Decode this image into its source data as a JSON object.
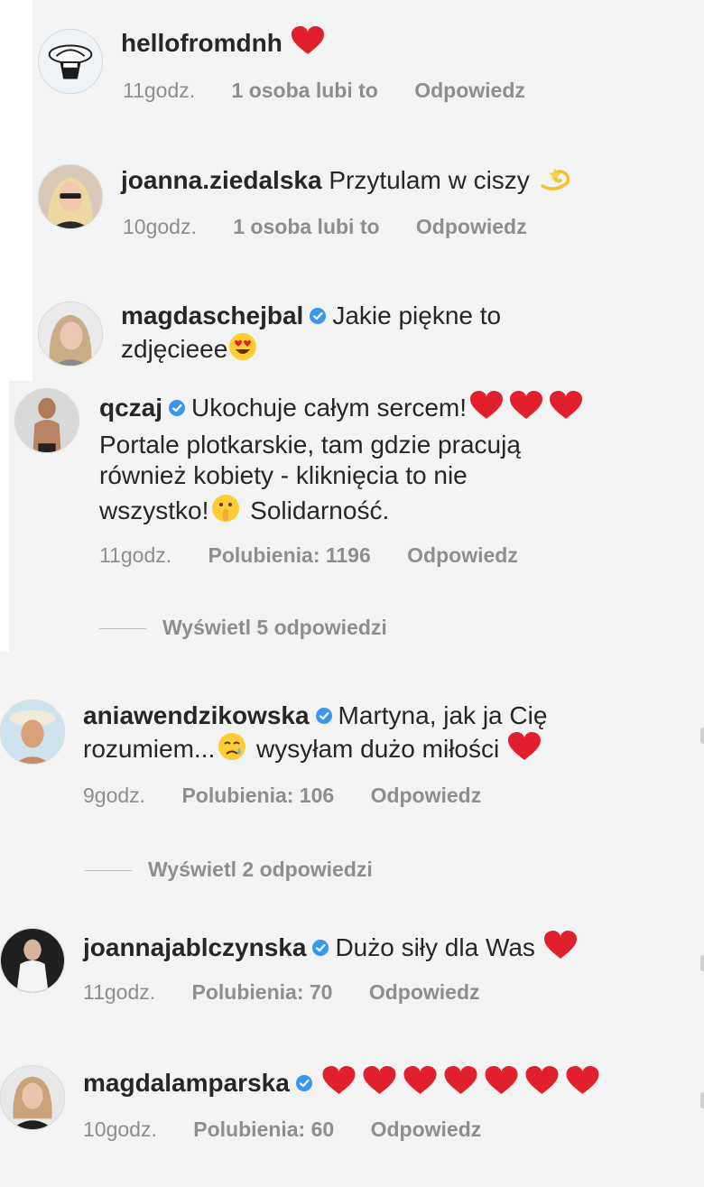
{
  "comments": [
    {
      "username": "hellofromdnh",
      "text": "",
      "emoji_after": "heart",
      "time": "11godz.",
      "likes": "1 osoba lubi to",
      "reply": "Odpowiedz"
    },
    {
      "username": "joanna.ziedalska",
      "text": "Przytulam w ciszy",
      "emoji_after": "dizzy",
      "time": "10godz.",
      "likes": "1 osoba lubi to",
      "reply": "Odpowiedz"
    },
    {
      "username": "magdaschejbal",
      "verified": true,
      "text_line1": "Jakie piękne to",
      "text_line2": "zdjęcieee",
      "emoji_after": "heart-eyes"
    },
    {
      "username": "qczaj",
      "verified": true,
      "text_line1": "Ukochuje całym sercem!",
      "text_line2": "Portale plotkarskie, tam gdzie pracują",
      "text_line3": "również kobiety - kliknięcia to nie",
      "text_line4a": "wszystko!",
      "text_line4b": "Solidarność.",
      "time": "11godz.",
      "likes": "Polubienia: 1196",
      "reply": "Odpowiedz",
      "view_replies": "Wyświetl 5 odpowiedzi"
    },
    {
      "username": "aniawendzikowska",
      "verified": true,
      "text_line1": "Martyna, jak ja Cię",
      "text_line2a": "rozumiem...",
      "text_line2b": "wysyłam dużo miłości",
      "time": "9godz.",
      "likes": "Polubienia: 106",
      "reply": "Odpowiedz",
      "view_replies": "Wyświetl 2 odpowiedzi"
    },
    {
      "username": "joannajablczynska",
      "verified": true,
      "text": "Dużo siły dla Was",
      "time": "11godz.",
      "likes": "Polubienia: 70",
      "reply": "Odpowiedz"
    },
    {
      "username": "magdalamparska",
      "verified": true,
      "text": "",
      "hearts": 7,
      "time": "10godz.",
      "likes": "Polubienia: 60",
      "reply": "Odpowiedz"
    }
  ],
  "colors": {
    "background": "#f3f3f3",
    "text": "#262626",
    "meta": "#8e8e8e",
    "verified": "#3897f0",
    "heart": "#e0202c"
  }
}
